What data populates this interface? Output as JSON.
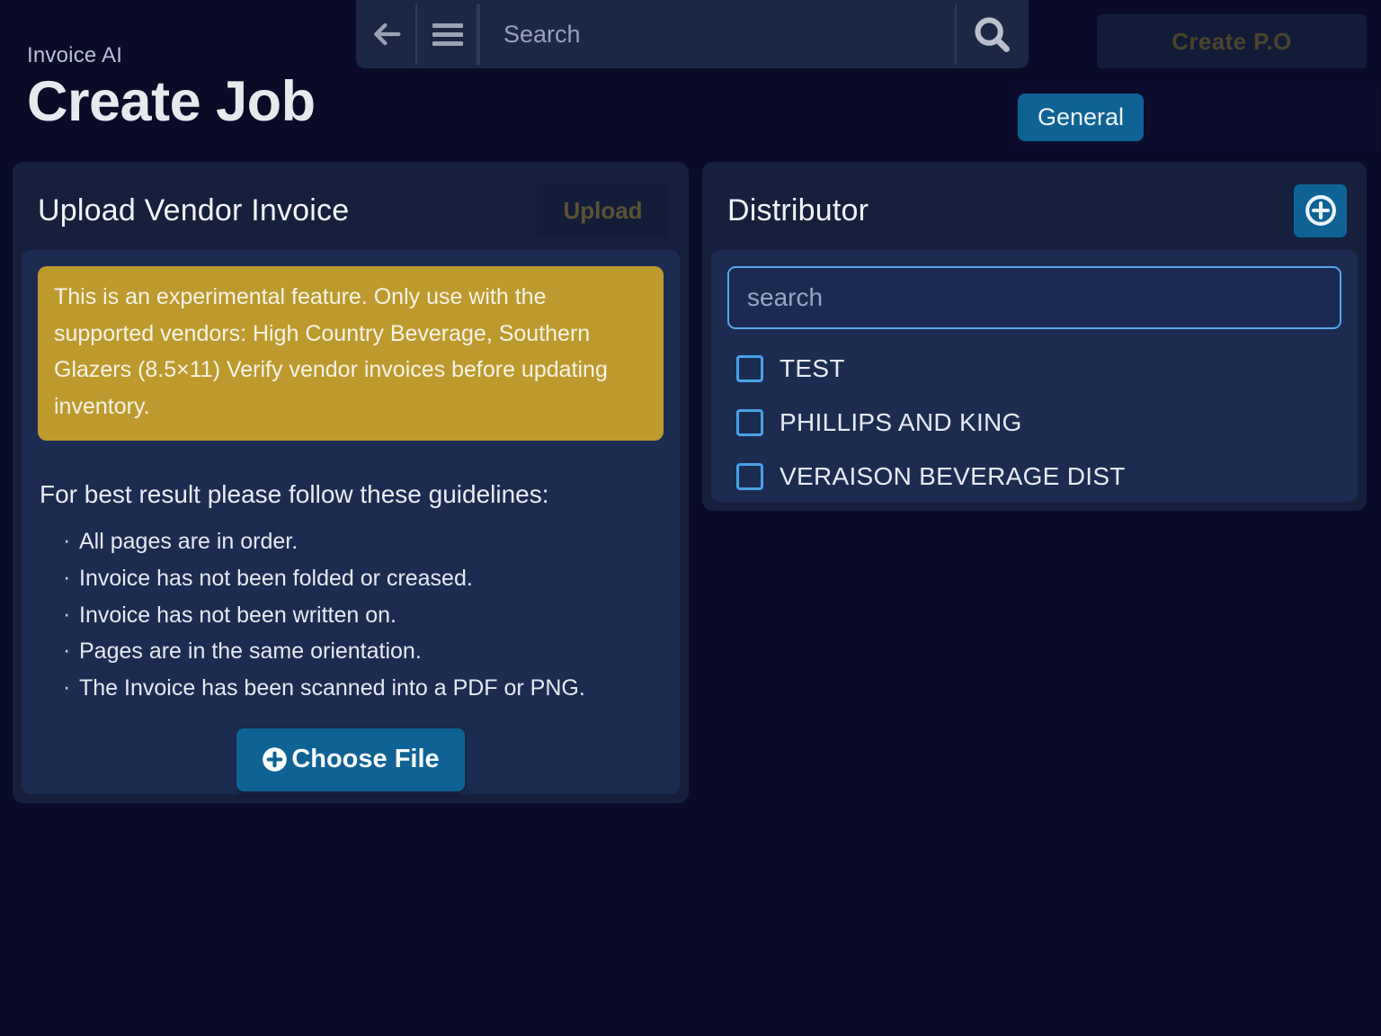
{
  "topbar": {
    "back_icon": "arrow-left-icon",
    "menu_icon": "hamburger-menu-icon",
    "search_placeholder": "Search",
    "search_value": "",
    "search_icon": "magnifier-icon"
  },
  "header": {
    "create_po_label": "Create P.O",
    "eyebrow": "Invoice AI",
    "title": "Create Job"
  },
  "tabs": [
    {
      "label": "General",
      "active": true
    }
  ],
  "upload_panel": {
    "title": "Upload Vendor Invoice",
    "upload_label": "Upload",
    "warning": "This is an experimental feature. Only use with the supported vendors: High Country Beverage, Southern Glazers (8.5×11) Verify vendor invoices before updating inventory.",
    "guidelines_title": "For best result please follow these guidelines:",
    "guidelines": [
      "All pages are in order.",
      "Invoice has not been folded or creased.",
      "Invoice has not been written on.",
      "Pages are in the same orientation.",
      "The Invoice has been scanned into a PDF or PNG."
    ],
    "choose_file_label": "Choose File",
    "choose_file_icon": "plus-circle-icon"
  },
  "distributor_panel": {
    "title": "Distributor",
    "add_icon": "plus-circle-icon",
    "search_placeholder": "search",
    "search_value": "",
    "items": [
      {
        "label": "TEST",
        "checked": false
      },
      {
        "label": "PHILLIPS AND KING",
        "checked": false
      },
      {
        "label": "VERAISON BEVERAGE DIST",
        "checked": false
      }
    ]
  },
  "colors": {
    "page_background": "#0a0b26",
    "card_outer": "#16203c",
    "card_inner": "#1c2c51",
    "accent_blue": "#0f6394",
    "warning_gold": "#bd9a2d",
    "checkbox_blue": "#49a3e6",
    "muted_gold_text": "#5b5231"
  }
}
